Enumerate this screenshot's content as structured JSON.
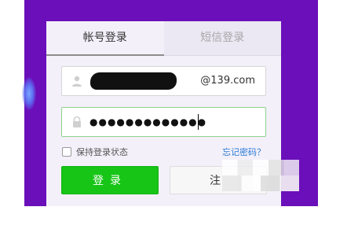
{
  "tabs": [
    {
      "label": "帐号登录",
      "active": true
    },
    {
      "label": "短信登录",
      "active": false
    }
  ],
  "account": {
    "icon": "user-icon",
    "suffix": "@139.com"
  },
  "password": {
    "icon": "lock-icon",
    "masked_value": "●●●●●●●●●●●●●"
  },
  "remember": {
    "label": "保持登录状态",
    "checked": false
  },
  "forgot_label": "忘记密码？",
  "buttons": {
    "login": "登录",
    "register": "注"
  },
  "colors": {
    "background": "#6a0fba",
    "login_button": "#17c517",
    "link": "#2a7bd4"
  }
}
